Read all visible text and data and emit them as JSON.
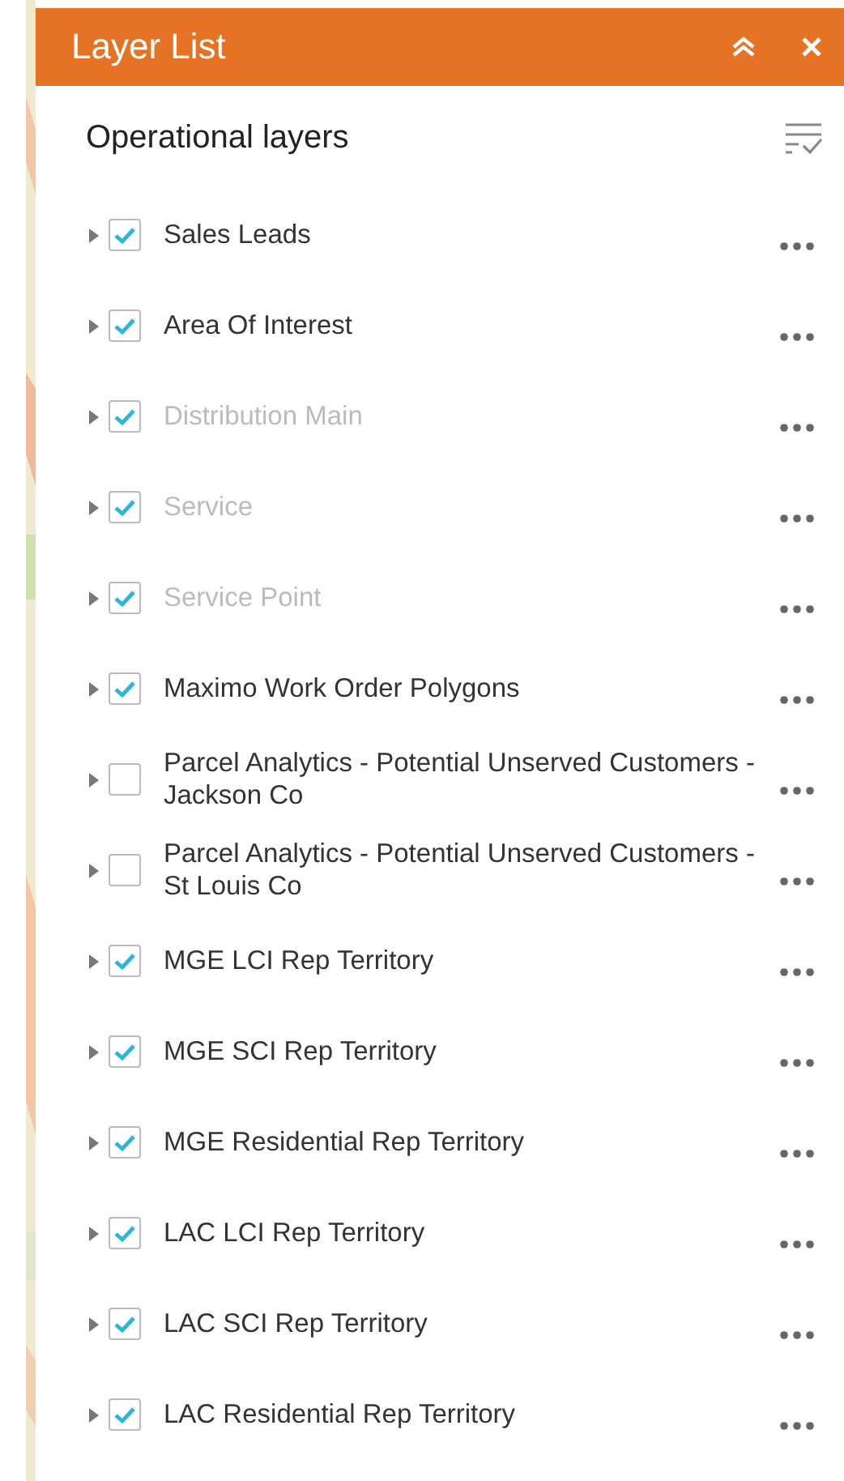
{
  "panel": {
    "title": "Layer List",
    "section_title": "Operational layers"
  },
  "layers": [
    {
      "name": "Sales Leads",
      "checked": true,
      "disabled": false
    },
    {
      "name": "Area Of Interest",
      "checked": true,
      "disabled": false
    },
    {
      "name": "Distribution Main",
      "checked": true,
      "disabled": true
    },
    {
      "name": "Service",
      "checked": true,
      "disabled": true
    },
    {
      "name": "Service Point",
      "checked": true,
      "disabled": true
    },
    {
      "name": "Maximo Work Order Polygons",
      "checked": true,
      "disabled": false
    },
    {
      "name": "Parcel Analytics - Potential Unserved Customers - Jackson Co",
      "checked": false,
      "disabled": false
    },
    {
      "name": "Parcel Analytics - Potential Unserved Customers - St Louis Co",
      "checked": false,
      "disabled": false
    },
    {
      "name": "MGE LCI Rep Territory",
      "checked": true,
      "disabled": false
    },
    {
      "name": "MGE SCI Rep Territory",
      "checked": true,
      "disabled": false
    },
    {
      "name": "MGE Residential Rep Territory",
      "checked": true,
      "disabled": false
    },
    {
      "name": "LAC LCI Rep Territory",
      "checked": true,
      "disabled": false
    },
    {
      "name": "LAC SCI Rep Territory",
      "checked": true,
      "disabled": false
    },
    {
      "name": "LAC Residential Rep Territory",
      "checked": true,
      "disabled": false
    }
  ]
}
